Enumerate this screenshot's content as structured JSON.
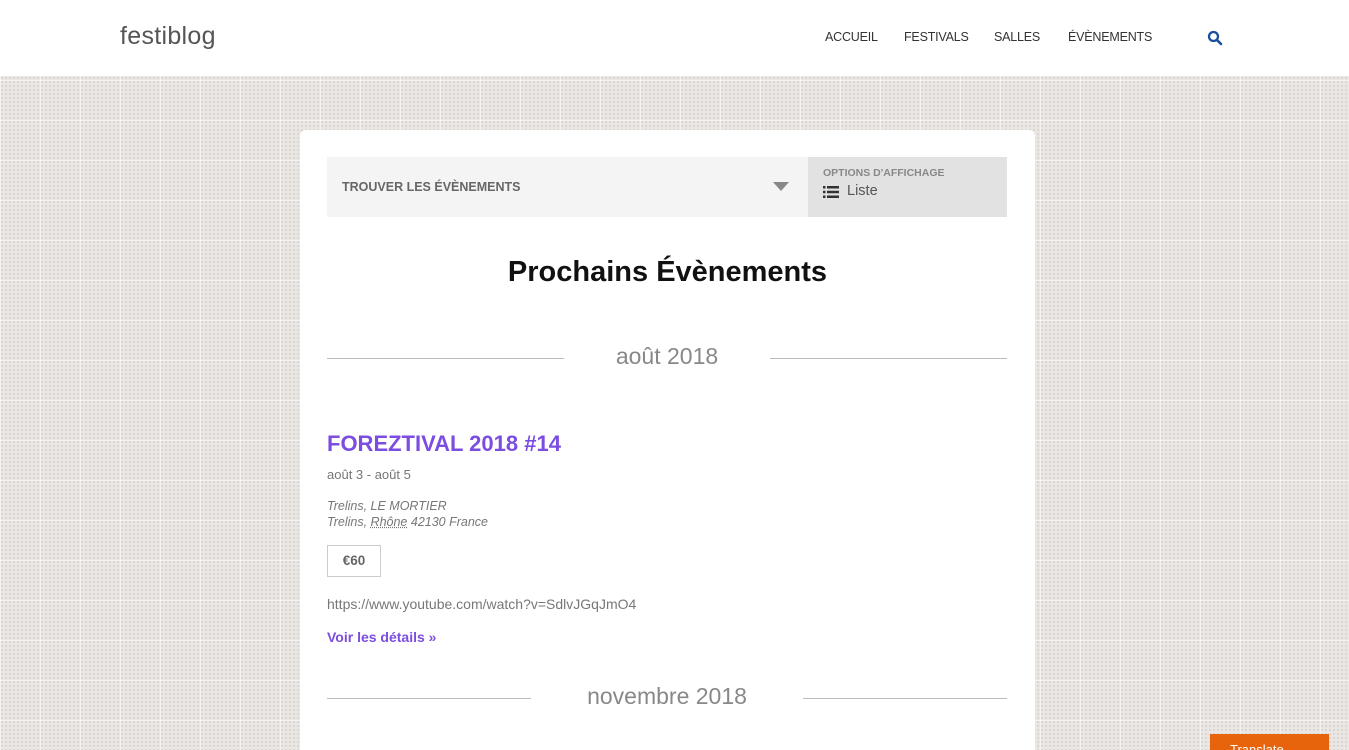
{
  "header": {
    "logo": "festiblog",
    "nav": [
      "ACCUEIL",
      "FESTIVALS",
      "SALLES",
      "ÉVÈNEMENTS"
    ]
  },
  "filter_bar": {
    "find_label": "TROUVER LES ÉVÈNEMENTS",
    "options_label": "OPTIONS D'AFFICHAGE",
    "view_label": "Liste"
  },
  "page_title": "Prochains Évènements",
  "months": [
    "août 2018",
    "novembre 2018"
  ],
  "event": {
    "title": "FOREZTIVAL 2018 #14",
    "dates": "août 3 - août 5",
    "venue_line1": "Trelins, LE MORTIER",
    "venue_city": "Trelins,",
    "venue_region": "Rhône",
    "venue_rest": "42130 France",
    "price": "€60",
    "link": "https://www.youtube.com/watch?v=SdlvJGqJmO4",
    "details": "Voir les détails »"
  },
  "translate_label": "Translate",
  "colors": {
    "accent": "#7b4de0",
    "search_icon": "#1a4f9c",
    "translate": "#e8640c"
  }
}
